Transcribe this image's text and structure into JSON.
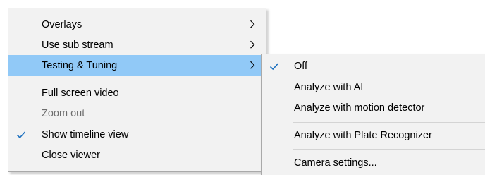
{
  "main_menu": {
    "items": [
      {
        "label": "Overlays",
        "submenu": true
      },
      {
        "label": "Use sub stream",
        "submenu": true
      },
      {
        "label": "Testing & Tuning",
        "submenu": true,
        "highlighted": true
      },
      {
        "label": "Full screen video"
      },
      {
        "label": "Zoom out",
        "disabled": true
      },
      {
        "label": "Show timeline view",
        "checked": true
      },
      {
        "label": "Close viewer"
      }
    ]
  },
  "sub_menu": {
    "items": [
      {
        "label": "Off",
        "checked": true
      },
      {
        "label": "Analyze with AI"
      },
      {
        "label": "Analyze with motion detector"
      },
      {
        "label": "Analyze with Plate Recognizer"
      },
      {
        "label": "Camera settings..."
      }
    ]
  },
  "colors": {
    "menu_background": "#f2f2f2",
    "highlight": "#91c9f7",
    "disabled_text": "#6d6d6d",
    "check_mark": "#1a6fbf"
  },
  "icons": {
    "submenu_arrow": "chevron-right-icon",
    "check": "check-icon"
  }
}
